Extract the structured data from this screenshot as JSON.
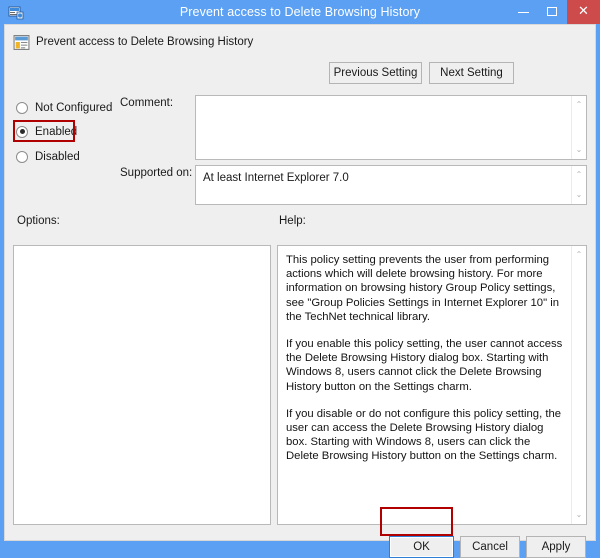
{
  "titlebar": {
    "title": "Prevent access to Delete Browsing History",
    "icon": "group-policy-editor-icon",
    "minimize_label": "–",
    "maximize_label": "□",
    "close_label": "✕"
  },
  "header": {
    "icon": "policy-setting-icon",
    "title": "Prevent access to Delete Browsing History",
    "previous_setting_label": "Previous Setting",
    "next_setting_label": "Next Setting"
  },
  "state_options": [
    {
      "label": "Not Configured",
      "selected": false
    },
    {
      "label": "Enabled",
      "selected": true
    },
    {
      "label": "Disabled",
      "selected": false
    }
  ],
  "fields": {
    "comment_label": "Comment:",
    "comment_value": "",
    "supported_on_label": "Supported on:",
    "supported_on_value": "At least Internet Explorer 7.0"
  },
  "panels": {
    "options_label": "Options:",
    "options_value": "",
    "help_label": "Help:",
    "help_paragraphs": [
      "This policy setting prevents the user from performing actions which will delete browsing history. For more information on browsing history Group Policy settings, see \"Group Policies Settings in Internet Explorer 10\" in the TechNet technical library.",
      "If you enable this policy setting, the user cannot access the Delete Browsing History dialog box. Starting with Windows 8, users cannot click the Delete Browsing History button on the Settings charm.",
      "If you disable or do not configure this policy setting, the user can access the Delete Browsing History dialog box. Starting with Windows 8, users can click the Delete Browsing History button on the Settings charm."
    ]
  },
  "footer": {
    "ok_label": "OK",
    "cancel_label": "Cancel",
    "apply_label": "Apply"
  },
  "scrollbar": {
    "up_arrow": "⌃",
    "down_arrow": "⌄"
  },
  "annotations": {
    "highlight_color": "#b00000",
    "targets": [
      "enabled-radio",
      "ok-button"
    ]
  },
  "colors": {
    "titlebar": "#5ba0f2",
    "close_button": "#cd4b4b",
    "dialog_background": "#efefef",
    "field_background": "#ffffff"
  }
}
